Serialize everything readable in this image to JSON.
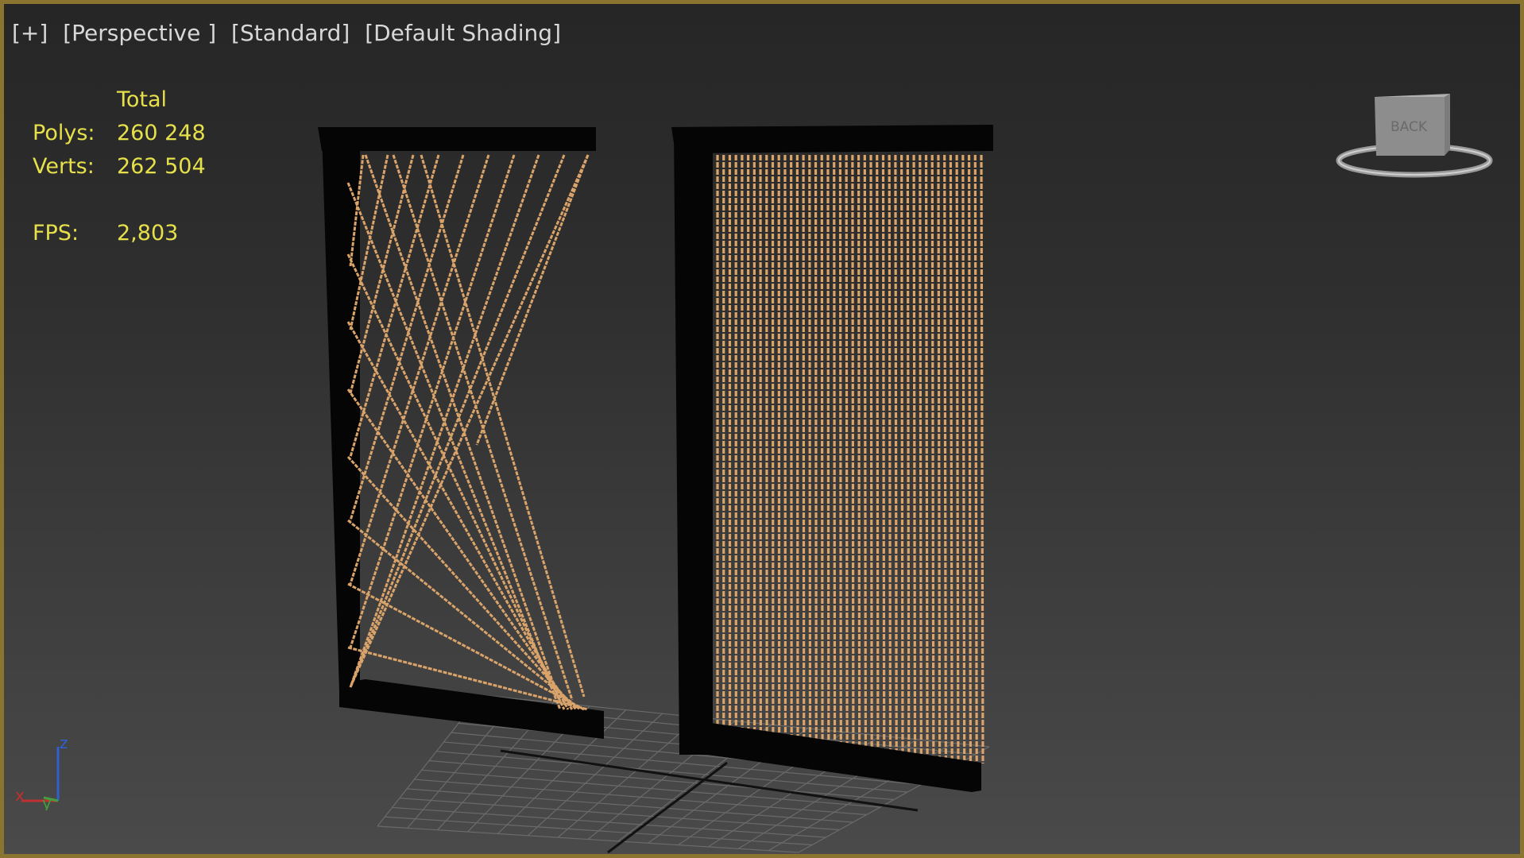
{
  "viewport": {
    "labels": {
      "plus": "[+]",
      "view": "[Perspective ]",
      "mode": "[Standard]",
      "shading": "[Default Shading]"
    },
    "border_color": "#8a7430"
  },
  "stats": {
    "header": "Total",
    "polys_label": "Polys:",
    "polys_value": "260 248",
    "verts_label": "Verts:",
    "verts_value": "262 504",
    "fps_label": "FPS:",
    "fps_value": "2,803",
    "color": "#e6e04a"
  },
  "viewcube": {
    "face_label": "BACK",
    "icon": "viewcube-icon"
  },
  "axis": {
    "x": "x",
    "y": "y",
    "z": "z",
    "x_color": "#c03030",
    "y_color": "#40a040",
    "z_color": "#3060d0"
  },
  "scene": {
    "rope_color": "#d9a36a",
    "frame_color": "#050505"
  }
}
